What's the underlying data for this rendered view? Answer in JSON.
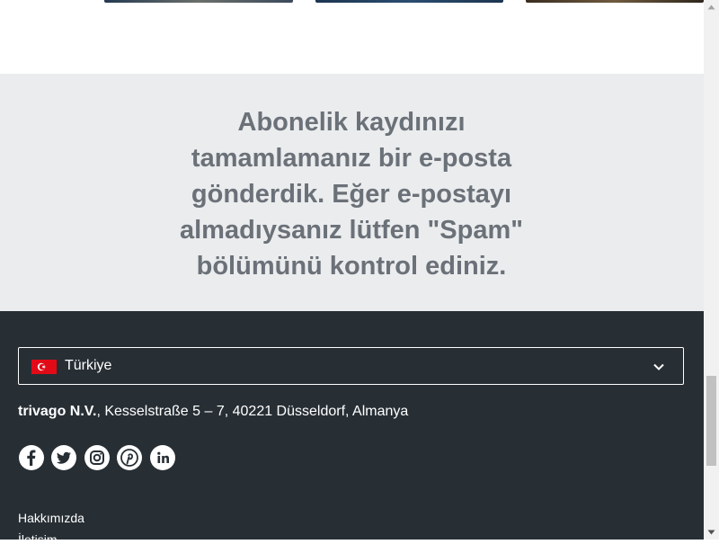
{
  "confirmation": {
    "message": "Abonelik kaydınızı tamamlamanız bir e-posta gönderdik. Eğer e-postayı almadıysanız lütfen \"Spam\" bölümünü kontrol ediniz."
  },
  "footer": {
    "country_select": {
      "selected": "Türkiye",
      "flag_icon": "turkey-flag-icon"
    },
    "company_name": "trivago N.V.",
    "address": ", Kesselstraße 5 – 7, 40221 Düsseldorf, Almanya",
    "social": [
      {
        "icon": "facebook-icon"
      },
      {
        "icon": "twitter-icon"
      },
      {
        "icon": "instagram-icon"
      },
      {
        "icon": "pinterest-icon"
      },
      {
        "icon": "linkedin-icon"
      }
    ],
    "links": [
      "Hakkımızda",
      "İletişim"
    ]
  },
  "colors": {
    "confirm_bg": "#ebecee",
    "confirm_text": "#6b7178",
    "footer_bg": "#272f35"
  }
}
